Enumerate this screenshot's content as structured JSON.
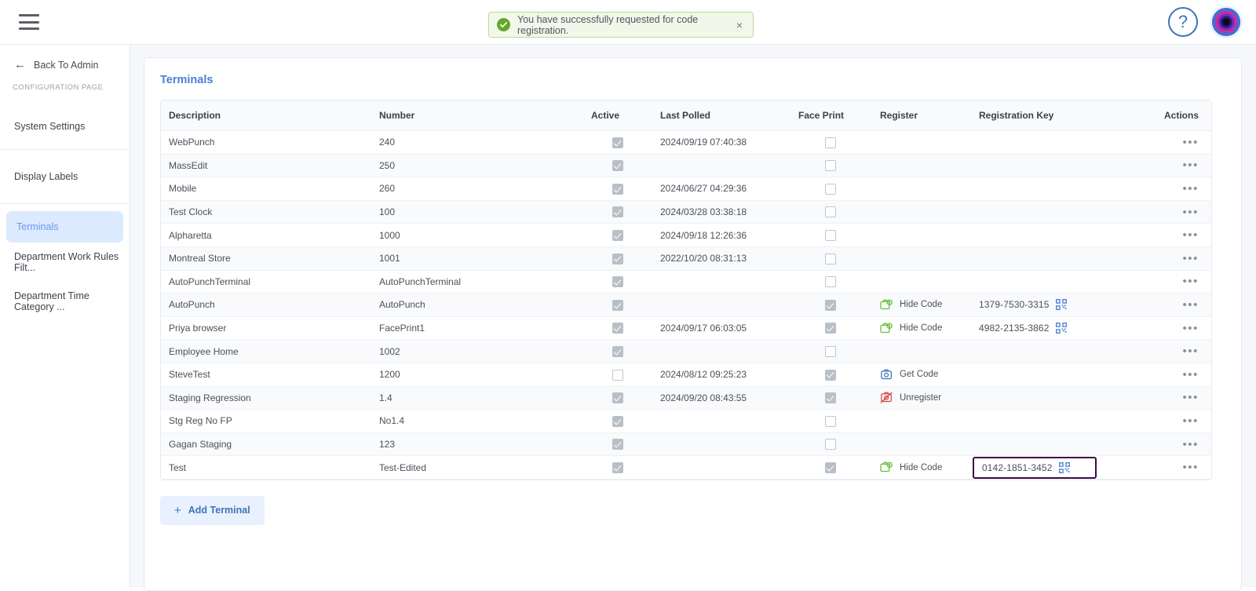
{
  "topbar": {
    "menu_icon": "hamburger-menu-icon",
    "help_icon": "?",
    "help_label": "Help",
    "avatar_label": "User avatar"
  },
  "toast": {
    "message": "You have successfully requested for code registration.",
    "close_label": "×",
    "icon": "success-check-icon",
    "accent_color": "#63a829",
    "background": "#f2f8e9",
    "border": "#bcd99a"
  },
  "sidebar": {
    "back_label": "Back To Admin",
    "section_label": "CONFIGURATION PAGE",
    "groups": [
      {
        "items": [
          {
            "label": "System Settings",
            "active": false
          }
        ]
      },
      {
        "items": [
          {
            "label": "Display Labels",
            "active": false
          }
        ]
      },
      {
        "items": [
          {
            "label": "Terminals",
            "active": true
          },
          {
            "label": "Department Work Rules Filt...",
            "active": false
          },
          {
            "label": "Department Time Category ...",
            "active": false
          }
        ]
      }
    ],
    "active_color": "#6b9ae8",
    "active_bg": "#dbeafe"
  },
  "main": {
    "title": "Terminals",
    "title_color": "#4a7fd4",
    "add_button": "Add Terminal",
    "add_button_icon": "+",
    "columns": [
      "Description",
      "Number",
      "Active",
      "Last Polled",
      "Face Print",
      "Register",
      "Registration Key",
      "Actions"
    ],
    "actions_glyph": "•••",
    "rows": [
      {
        "description": "WebPunch",
        "number": "240",
        "active": true,
        "last_polled": "2024/09/19 07:40:38",
        "face_print": false,
        "register": null,
        "register_icon": null,
        "key": null,
        "highlighted": false
      },
      {
        "description": "MassEdit",
        "number": "250",
        "active": true,
        "last_polled": "",
        "face_print": false,
        "register": null,
        "register_icon": null,
        "key": null,
        "highlighted": false
      },
      {
        "description": "Mobile",
        "number": "260",
        "active": true,
        "last_polled": "2024/06/27 04:29:36",
        "face_print": false,
        "register": null,
        "register_icon": null,
        "key": null,
        "highlighted": false
      },
      {
        "description": "Test Clock",
        "number": "100",
        "active": true,
        "last_polled": "2024/03/28 03:38:18",
        "face_print": false,
        "register": null,
        "register_icon": null,
        "key": null,
        "highlighted": false
      },
      {
        "description": "Alpharetta",
        "number": "1000",
        "active": true,
        "last_polled": "2024/09/18 12:26:36",
        "face_print": false,
        "register": null,
        "register_icon": null,
        "key": null,
        "highlighted": false
      },
      {
        "description": "Montreal Store",
        "number": "1001",
        "active": true,
        "last_polled": "2022/10/20 08:31:13",
        "face_print": false,
        "register": null,
        "register_icon": null,
        "key": null,
        "highlighted": false
      },
      {
        "description": "AutoPunchTerminal",
        "number": "AutoPunchTerminal",
        "active": true,
        "last_polled": "",
        "face_print": false,
        "register": null,
        "register_icon": null,
        "key": null,
        "highlighted": false
      },
      {
        "description": "AutoPunch",
        "number": "AutoPunch",
        "active": true,
        "last_polled": "",
        "face_print": true,
        "register": "Hide Code",
        "register_icon": "hide-code-icon",
        "key": "1379-7530-3315",
        "highlighted": false
      },
      {
        "description": "Priya browser",
        "number": "FacePrint1",
        "active": true,
        "last_polled": "2024/09/17 06:03:05",
        "face_print": true,
        "register": "Hide Code",
        "register_icon": "hide-code-icon",
        "key": "4982-2135-3862",
        "highlighted": false
      },
      {
        "description": "Employee Home",
        "number": "1002",
        "active": true,
        "last_polled": "",
        "face_print": false,
        "register": null,
        "register_icon": null,
        "key": null,
        "highlighted": false
      },
      {
        "description": "SteveTest",
        "number": "1200",
        "active": false,
        "last_polled": "2024/08/12 09:25:23",
        "face_print": true,
        "register": "Get Code",
        "register_icon": "get-code-icon",
        "key": null,
        "highlighted": false
      },
      {
        "description": "Staging Regression",
        "number": "1.4",
        "active": true,
        "last_polled": "2024/09/20 08:43:55",
        "face_print": true,
        "register": "Unregister",
        "register_icon": "unregister-icon",
        "key": null,
        "highlighted": false
      },
      {
        "description": "Stg Reg No FP",
        "number": "No1.4",
        "active": true,
        "last_polled": "",
        "face_print": false,
        "register": null,
        "register_icon": null,
        "key": null,
        "highlighted": false
      },
      {
        "description": "Gagan Staging",
        "number": "123",
        "active": true,
        "last_polled": "",
        "face_print": false,
        "register": null,
        "register_icon": null,
        "key": null,
        "highlighted": false
      },
      {
        "description": "Test",
        "number": "Test-Edited",
        "active": true,
        "last_polled": "",
        "face_print": true,
        "register": "Hide Code",
        "register_icon": "hide-code-icon",
        "key": "0142-1851-3452",
        "highlighted": true
      }
    ],
    "highlight_border_color": "#3d0b45",
    "hide_code_color": "#6abf3e",
    "get_code_color": "#3f74b8",
    "unregister_color": "#d9433f",
    "qr_color": "#4a7fd4"
  }
}
